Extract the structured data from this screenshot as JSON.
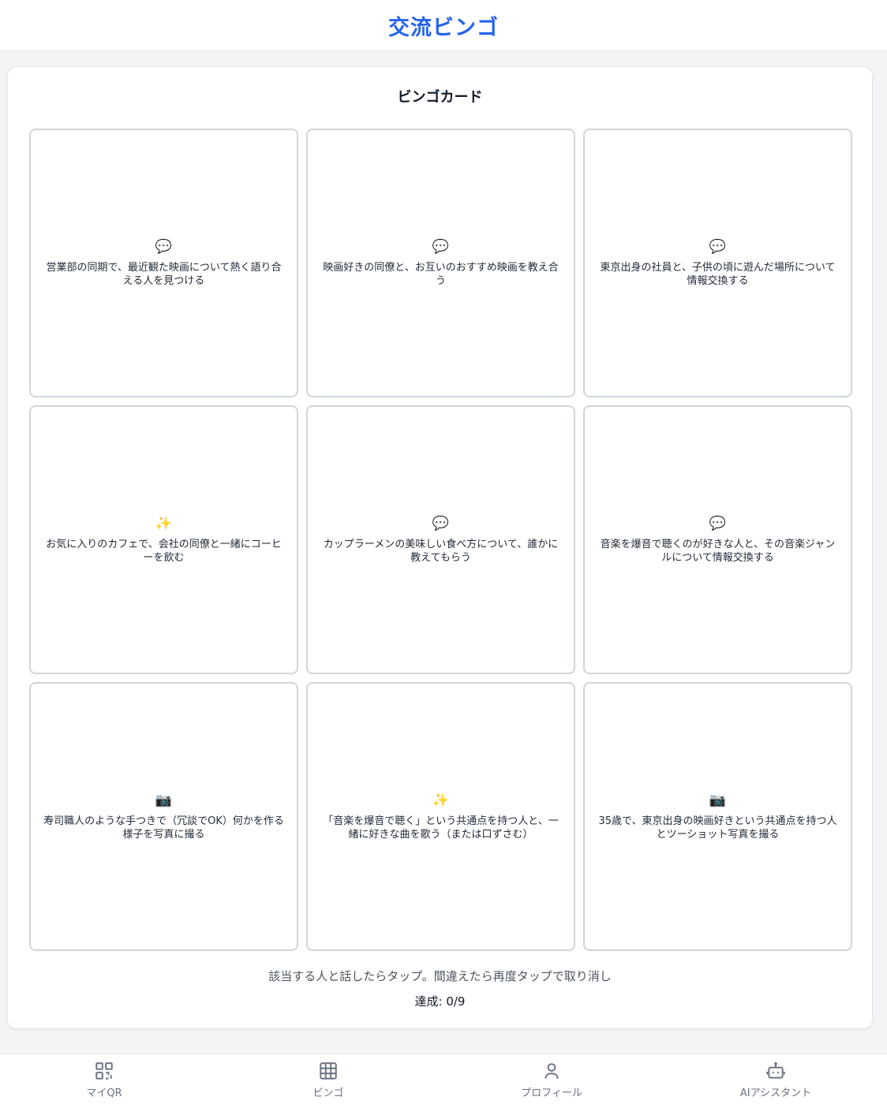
{
  "header": {
    "title": "交流ビンゴ"
  },
  "card": {
    "title": "ビンゴカード",
    "cells": [
      {
        "icon": "💬",
        "icon_name": "chat-bubble-icon",
        "text": "営業部の同期で、最近観た映画について熱く語り合える人を見つける"
      },
      {
        "icon": "💬",
        "icon_name": "chat-bubble-icon",
        "text": "映画好きの同僚と、お互いのおすすめ映画を教え合う"
      },
      {
        "icon": "💬",
        "icon_name": "chat-bubble-icon",
        "text": "東京出身の社員と、子供の頃に遊んだ場所について情報交換する"
      },
      {
        "icon": "✨",
        "icon_name": "sparkles-icon",
        "text": "お気に入りのカフェで、会社の同僚と一緒にコーヒーを飲む"
      },
      {
        "icon": "💬",
        "icon_name": "chat-bubble-icon",
        "text": "カップラーメンの美味しい食べ方について、誰かに教えてもらう"
      },
      {
        "icon": "💬",
        "icon_name": "chat-bubble-icon",
        "text": "音楽を爆音で聴くのが好きな人と、その音楽ジャンルについて情報交換する"
      },
      {
        "icon": "📷",
        "icon_name": "camera-icon",
        "text": "寿司職人のような手つきで（冗談でOK）何かを作る様子を写真に撮る"
      },
      {
        "icon": "✨",
        "icon_name": "sparkles-icon",
        "text": "「音楽を爆音で聴く」という共通点を持つ人と、一緒に好きな曲を歌う（または口ずさむ）"
      },
      {
        "icon": "📷",
        "icon_name": "camera-icon",
        "text": "35歳で、東京出身の映画好きという共通点を持つ人とツーショット写真を撮る"
      }
    ],
    "hint": "該当する人と話したらタップ。間違えたら再度タップで取り消し",
    "progress": "達成: 0/9"
  },
  "nav": {
    "items": [
      {
        "label": "マイQR",
        "icon": "qr-code-icon"
      },
      {
        "label": "ビンゴ",
        "icon": "grid-icon"
      },
      {
        "label": "プロフィール",
        "icon": "user-icon"
      },
      {
        "label": "AIアシスタント",
        "icon": "robot-icon"
      }
    ]
  },
  "colors": {
    "accent": "#2563eb",
    "nav_text": "#6b7280",
    "cell_border": "#d1d5db"
  }
}
